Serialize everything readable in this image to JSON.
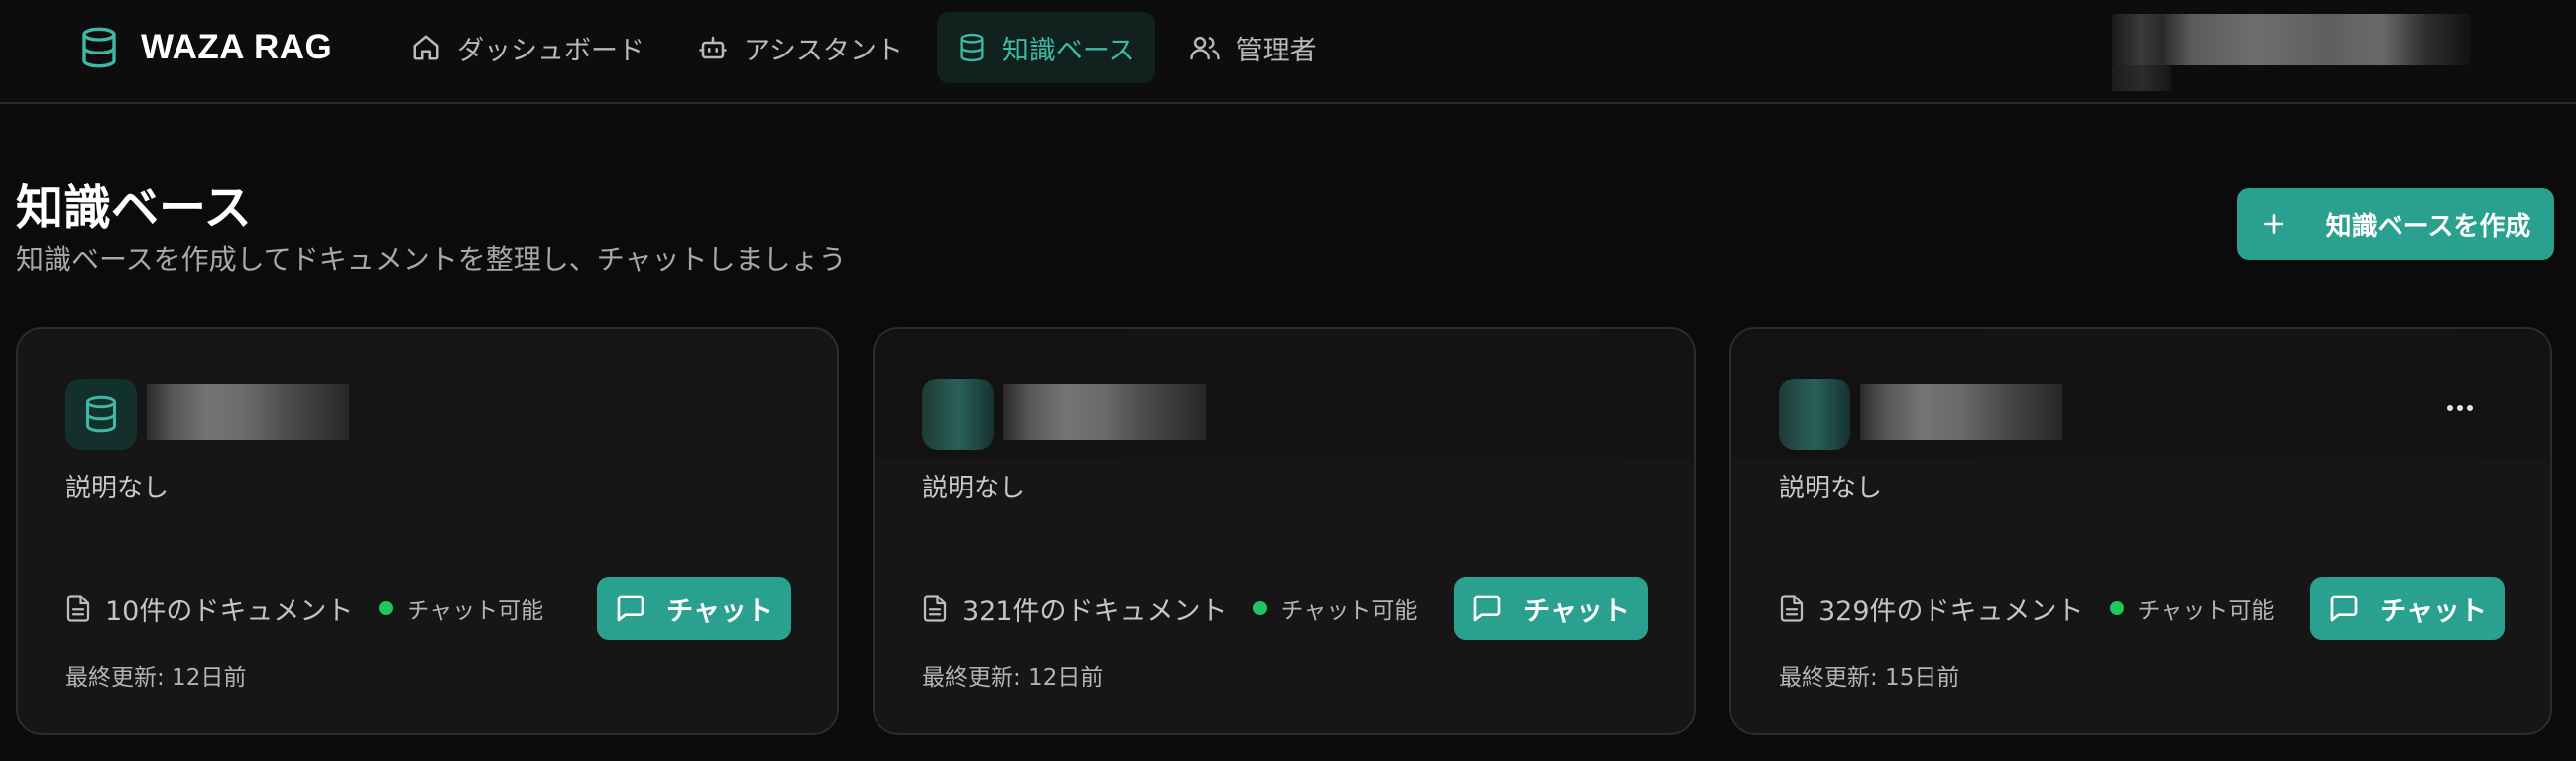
{
  "app": {
    "brand": "WAZA RAG"
  },
  "nav": {
    "items": [
      {
        "label": "ダッシュボード",
        "icon": "home-icon",
        "active": false
      },
      {
        "label": "アシスタント",
        "icon": "bot-icon",
        "active": false
      },
      {
        "label": "知識ベース",
        "icon": "database-icon",
        "active": true
      },
      {
        "label": "管理者",
        "icon": "users-icon",
        "active": false
      }
    ]
  },
  "page": {
    "title": "知識ベース",
    "subtitle": "知識ベースを作成してドキュメントを整理し、チャットしましょう",
    "create_button": "知識ベースを作成"
  },
  "cards": [
    {
      "description": "説明なし",
      "doc_count": "10件のドキュメント",
      "status": "チャット可能",
      "chat_label": "チャット",
      "updated": "最終更新: 12日前"
    },
    {
      "description": "説明なし",
      "doc_count": "321件のドキュメント",
      "status": "チャット可能",
      "chat_label": "チャット",
      "updated": "最終更新: 12日前"
    },
    {
      "description": "説明なし",
      "doc_count": "329件のドキュメント",
      "status": "チャット可能",
      "chat_label": "チャット",
      "updated": "最終更新: 15日前"
    }
  ],
  "colors": {
    "accent": "#2aa18f",
    "accent_text": "#3fb9a6",
    "status_ok": "#22c55e",
    "background": "#0b0b0b",
    "card": "#161616"
  }
}
